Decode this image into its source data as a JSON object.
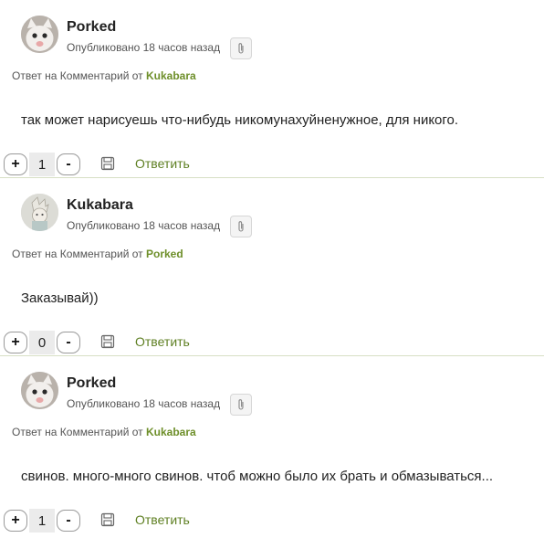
{
  "comments": [
    {
      "author": "Porked",
      "published": "Опубликовано 18 часов назад",
      "reply_prefix": "Ответ на Комментарий от",
      "reply_to": "Kukabara",
      "text": "так может нарисуешь что-нибудь никомунахуйненужное, для никого.",
      "plus": "+",
      "score": "1",
      "minus": "-",
      "reply_label": "Ответить"
    },
    {
      "author": "Kukabara",
      "published": "Опубликовано 18 часов назад",
      "reply_prefix": "Ответ на Комментарий от",
      "reply_to": "Porked",
      "text": "Заказывай))",
      "plus": "+",
      "score": "0",
      "minus": "-",
      "reply_label": "Ответить"
    },
    {
      "author": "Porked",
      "published": "Опубликовано 18 часов назад",
      "reply_prefix": "Ответ на Комментарий от",
      "reply_to": "Kukabara",
      "text": "свинов. много-много свинов. чтоб можно было их брать и обмазываться...",
      "plus": "+",
      "score": "1",
      "minus": "-",
      "reply_label": "Ответить"
    }
  ],
  "colors": {
    "accent_link": "#6e8f2a",
    "divider": "#d7dfc5"
  }
}
